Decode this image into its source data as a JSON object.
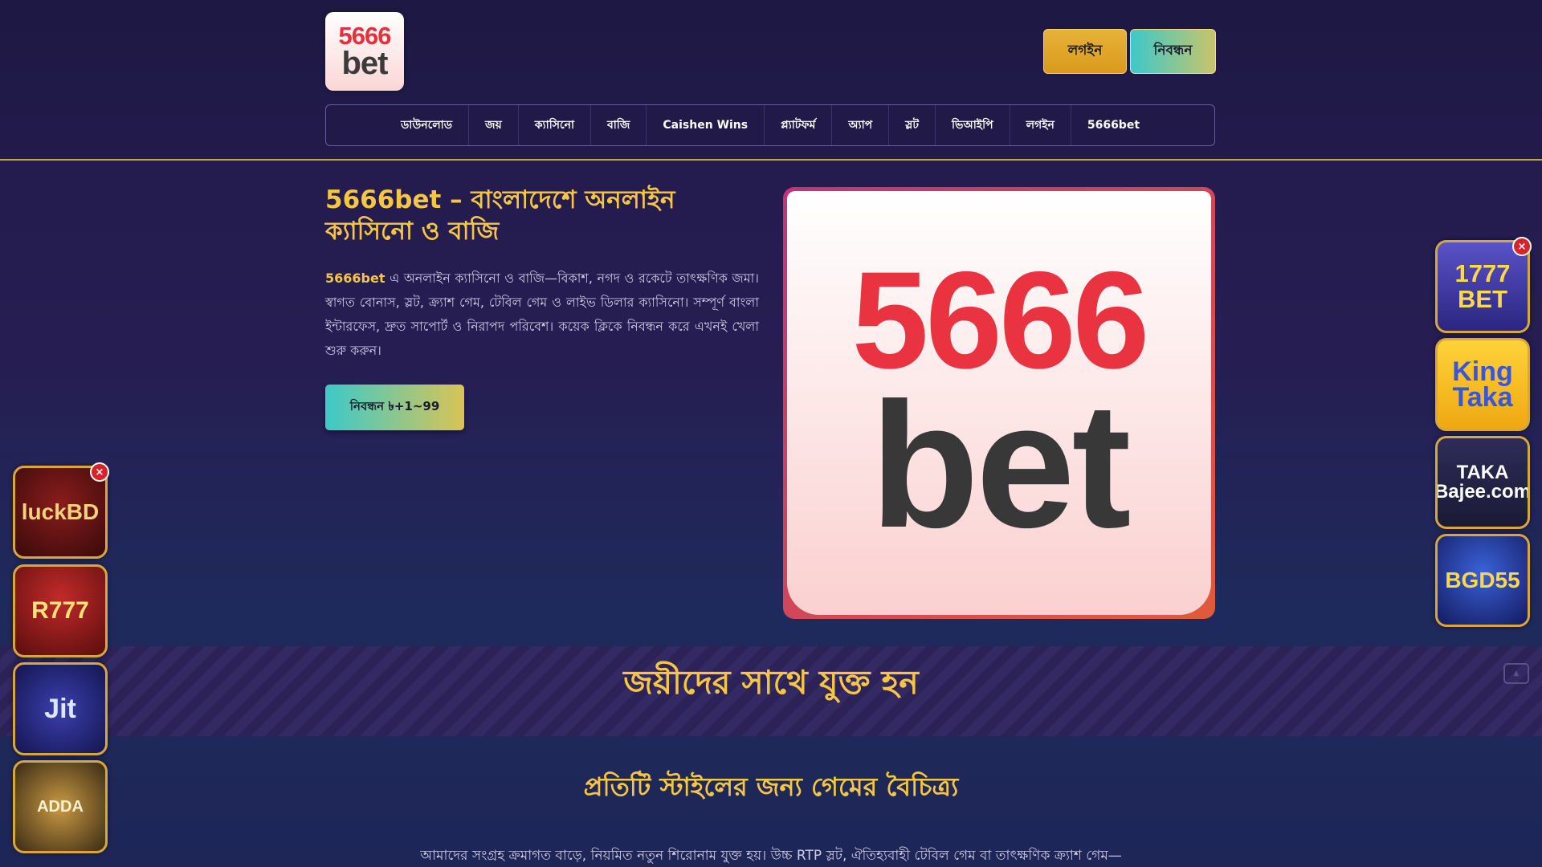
{
  "header": {
    "logo": {
      "line1": "5666",
      "line2": "bet"
    },
    "login_label": "লগইন",
    "register_label": "নিবন্ধন"
  },
  "nav": {
    "items": [
      {
        "label": "ডাউনলোড"
      },
      {
        "label": "জয়"
      },
      {
        "label": "ক্যাসিনো"
      },
      {
        "label": "বাজি"
      },
      {
        "label": "Caishen Wins"
      },
      {
        "label": "প্ল্যাটফর্ম"
      },
      {
        "label": "অ্যাপ"
      },
      {
        "label": "স্লট"
      },
      {
        "label": "ভিআইপি"
      },
      {
        "label": "লগইন"
      },
      {
        "label": "5666bet"
      }
    ]
  },
  "hero": {
    "title": "5666bet – বাংলাদেশে অনলাইন ক্যাসিনো ও বাজি",
    "brand": "5666bet",
    "text": " এ অনলাইন ক্যাসিনো ও বাজি—বিকাশ, নগদ ও রকেটে তাৎক্ষণিক জমা। স্বাগত বোনাস, স্লট, ক্র্যাশ গেম, টেবিল গেম ও লাইভ ডিলার ক্যাসিনো। সম্পূর্ণ বাংলা ইন্টারফেস, দ্রুত সাপোর্ট ও নিরাপদ পরিবেশ। কয়েক ক্লিকে নিবন্ধন করে এখনই খেলা শুরু করুন।",
    "cta_label": "নিবন্ধন ৳+1~99",
    "image": {
      "line1": "5666",
      "line2": "bet"
    }
  },
  "join": {
    "title": "জয়ীদের সাথে যুক্ত হন",
    "icon": "scroll-top-icon"
  },
  "games_section": {
    "title": "প্রতিটি স্টাইলের জন্য গেমের বৈচিত্র্য",
    "text": "আমাদের সংগ্রহ ক্রমাগত বাড়ে, নিয়মিত নতুন শিরোনাম যুক্ত হয়। উচ্চ RTP স্লট, ঐতিহ্যবাহী টেবিল গেম বা তাৎক্ষণিক ক্র্যাশ গেম—"
  },
  "left_ads": {
    "close_label": "×",
    "items": [
      {
        "label": "luckBD",
        "color": "#8a1c1c"
      },
      {
        "label": "R777",
        "color": "#c22a2a"
      },
      {
        "label": "Jit",
        "color": "#3b3fae"
      },
      {
        "label": "ADDA",
        "color": "#c99a44"
      }
    ]
  },
  "right_ads": {
    "close_label": "×",
    "items": [
      {
        "label": "1777 BET",
        "color": "#5a52c8"
      },
      {
        "label": "King Taka",
        "color": "#ffd23a"
      },
      {
        "label": "TAKA Bajee.com",
        "color": "#2c2c58"
      },
      {
        "label": "BGD55",
        "color": "#3a62d8"
      }
    ]
  },
  "colors": {
    "accent": "#f6c544",
    "background": "#241c4f",
    "header_border": "#c9a43a"
  }
}
